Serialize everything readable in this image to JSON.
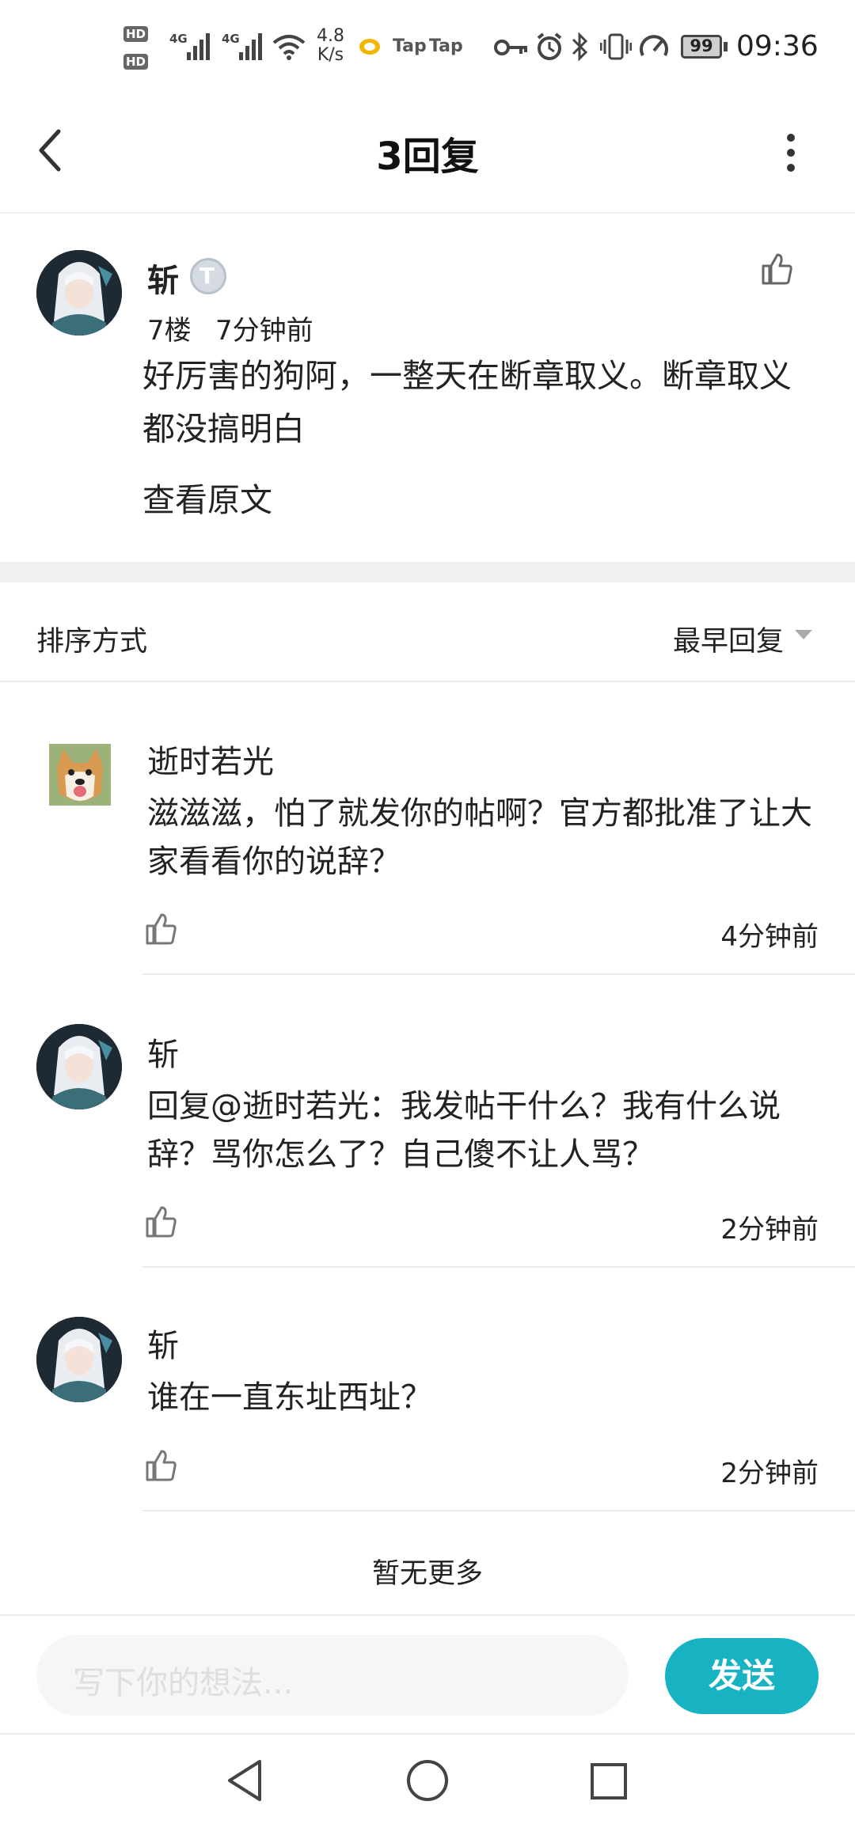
{
  "status_bar": {
    "hd1": "HD",
    "hd2": "HD",
    "net1": "4G",
    "net2": "4G",
    "speed_value": "4.8",
    "speed_unit": "K/s",
    "tap1": "Tap",
    "tap2": "Tap",
    "battery": "99",
    "time": "09:36"
  },
  "header": {
    "title": "3回复"
  },
  "main_post": {
    "author": "斩",
    "badge": "T",
    "floor": "7楼",
    "time": "7分钟前",
    "content": "好厉害的狗阿，一整天在断章取义。断章取义都没搞明白",
    "view_original": "查看原文"
  },
  "sort": {
    "label": "排序方式",
    "value": "最早回复"
  },
  "replies": [
    {
      "author": "逝时若光",
      "content": "滋滋滋，怕了就发你的帖啊？官方都批准了让大家看看你的说辞？",
      "time": "4分钟前"
    },
    {
      "author": "斩",
      "content": "回复@逝时若光：我发帖干什么？我有什么说辞？骂你怎么了？自己傻不让人骂？",
      "time": "2分钟前"
    },
    {
      "author": "斩",
      "content": "谁在一直东址西址？",
      "time": "2分钟前"
    }
  ],
  "no_more": "暂无更多",
  "composer": {
    "placeholder": "写下你的想法...",
    "send": "发送"
  },
  "colors": {
    "accent": "#17b3c2",
    "divider": "#ececec",
    "section_gap": "#f0f0f0"
  },
  "icons": [
    "back-arrow-icon",
    "more-vertical-icon",
    "thumbs-up-icon",
    "dropdown-triangle-icon",
    "nav-back-icon",
    "nav-home-icon",
    "nav-recents-icon"
  ]
}
